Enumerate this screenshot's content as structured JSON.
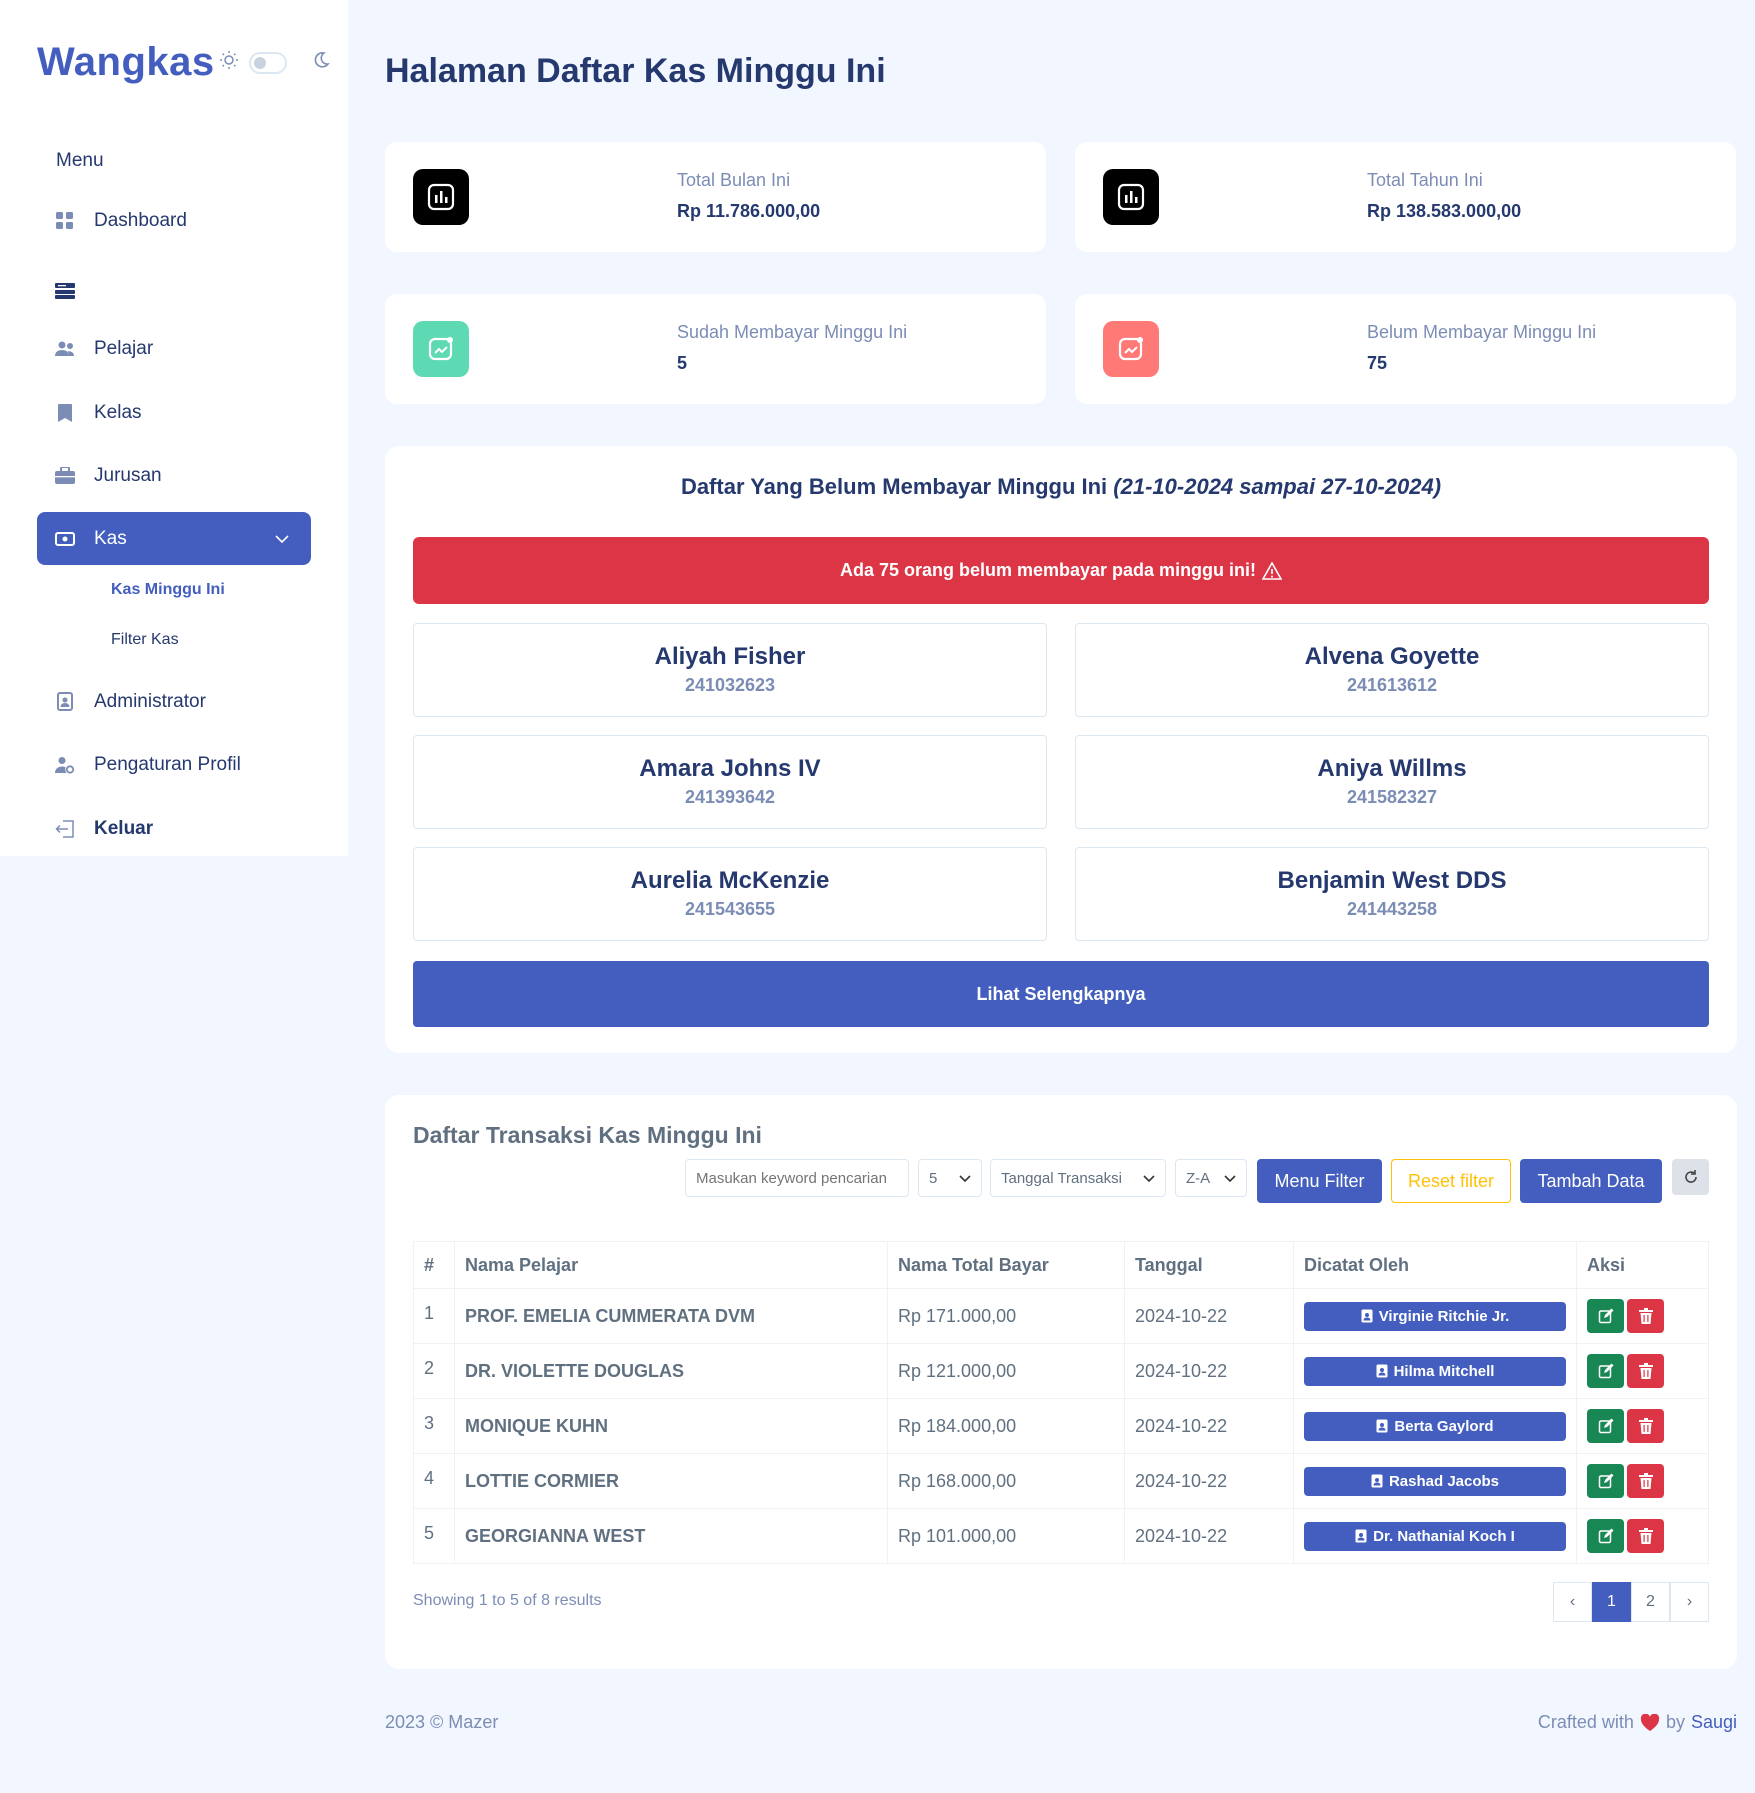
{
  "brand": "Wangkas",
  "sidebar": {
    "menu_title": "Menu",
    "items": [
      {
        "label": "Dashboard"
      },
      {
        "label": ""
      },
      {
        "label": "Pelajar"
      },
      {
        "label": "Kelas"
      },
      {
        "label": "Jurusan"
      },
      {
        "label": "Kas"
      },
      {
        "label": "Administrator"
      },
      {
        "label": "Pengaturan Profil"
      },
      {
        "label": "Keluar"
      }
    ],
    "kas_sub": [
      "Kas Minggu Ini",
      "Filter Kas"
    ]
  },
  "page_title": "Halaman Daftar Kas Minggu Ini",
  "stats": [
    {
      "label": "Total Bulan Ini",
      "value": "Rp 11.786.000,00",
      "color": "#000000"
    },
    {
      "label": "Total Tahun Ini",
      "value": "Rp 138.583.000,00",
      "color": "#000000"
    },
    {
      "label": "Sudah Membayar Minggu Ini",
      "value": "5",
      "color": "#57caeb"
    },
    {
      "label": "Belum Membayar Minggu Ini",
      "value": "75",
      "color": "#ff7976"
    }
  ],
  "unpaid": {
    "title": "Daftar Yang Belum Membayar Minggu Ini",
    "range": "(21-10-2024 sampai 27-10-2024)",
    "alert": "Ada 75 orang belum membayar pada minggu ini!",
    "people": [
      {
        "name": "Aliyah Fisher",
        "id": "241032623"
      },
      {
        "name": "Alvena Goyette",
        "id": "241613612"
      },
      {
        "name": "Amara Johns IV",
        "id": "241393642"
      },
      {
        "name": "Aniya Willms",
        "id": "241582327"
      },
      {
        "name": "Aurelia McKenzie",
        "id": "241543655"
      },
      {
        "name": "Benjamin West DDS",
        "id": "241443258"
      }
    ],
    "more_button": "Lihat Selengkapnya"
  },
  "transactions": {
    "title": "Daftar Transaksi Kas Minggu Ini",
    "search_placeholder": "Masukan keyword pencarian",
    "per_page": "5",
    "sort_field": "Tanggal Transaksi",
    "sort_order": "Z-A",
    "menu_filter": "Menu Filter",
    "reset_filter": "Reset filter",
    "add_data": "Tambah Data",
    "columns": [
      "#",
      "Nama Pelajar",
      "Nama Total Bayar",
      "Tanggal",
      "Dicatat Oleh",
      "Aksi"
    ],
    "rows": [
      {
        "no": "1",
        "name": "PROF. EMELIA CUMMERATA DVM",
        "amount": "Rp 171.000,00",
        "date": "2024-10-22",
        "by": "Virginie Ritchie Jr."
      },
      {
        "no": "2",
        "name": "DR. VIOLETTE DOUGLAS",
        "amount": "Rp 121.000,00",
        "date": "2024-10-22",
        "by": "Hilma Mitchell"
      },
      {
        "no": "3",
        "name": "MONIQUE KUHN",
        "amount": "Rp 184.000,00",
        "date": "2024-10-22",
        "by": "Berta Gaylord"
      },
      {
        "no": "4",
        "name": "LOTTIE CORMIER",
        "amount": "Rp 168.000,00",
        "date": "2024-10-22",
        "by": "Rashad Jacobs"
      },
      {
        "no": "5",
        "name": "GEORGIANNA WEST",
        "amount": "Rp 101.000,00",
        "date": "2024-10-22",
        "by": "Dr. Nathanial Koch I"
      }
    ],
    "showing": "Showing 1 to 5 of 8 results",
    "pages": [
      "‹",
      "1",
      "2",
      "›"
    ]
  },
  "footer": {
    "left": "2023 © Mazer",
    "crafted": "Crafted with",
    "by": "by",
    "author": "Saugi"
  }
}
